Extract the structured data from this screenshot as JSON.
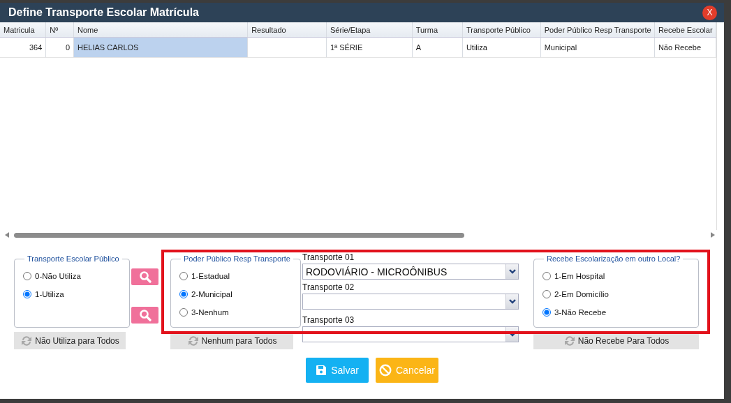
{
  "window": {
    "title": "Define Transporte Escolar Matrícula",
    "close_label": "X"
  },
  "table": {
    "columns": [
      "Matricula",
      "Nº",
      "Nome",
      "Resultado",
      "Série/Etapa",
      "Turma",
      "Transporte Público",
      "Poder Público Resp Transporte",
      "Recebe Escolar"
    ],
    "rows": [
      {
        "cells": [
          {
            "text": "364",
            "selected": false
          },
          {
            "text": "0",
            "selected": false
          },
          {
            "text": "HELIAS CARLOS",
            "selected": true
          },
          {
            "text": "",
            "selected": false
          },
          {
            "text": "1ª SÉRIE",
            "selected": false
          },
          {
            "text": "A",
            "selected": false
          },
          {
            "text": "Utiliza",
            "selected": false
          },
          {
            "text": "Municipal",
            "selected": false
          },
          {
            "text": "Não Recebe",
            "selected": false
          }
        ]
      }
    ]
  },
  "transporte_publico": {
    "legend": "Transporte Escolar Público",
    "options": [
      {
        "label": "0-Não Utiliza",
        "selected": false
      },
      {
        "label": "1-Utiliza",
        "selected": true
      }
    ],
    "all_button": "Não Utiliza para Todos"
  },
  "poder_publico": {
    "legend": "Poder Público Resp Transporte",
    "options": [
      {
        "label": "1-Estadual",
        "selected": false
      },
      {
        "label": "2-Municipal",
        "selected": true
      },
      {
        "label": "3-Nenhum",
        "selected": false
      }
    ],
    "all_button": "Nenhum para Todos"
  },
  "transportes": [
    {
      "label": "Transporte 01",
      "value": "RODOVIÁRIO - MICROÔNIBUS"
    },
    {
      "label": "Transporte 02"
    },
    {
      "label": "Transporte 03"
    }
  ],
  "escolarizacao": {
    "legend": "Recebe Escolarização em outro Local?",
    "options": [
      {
        "label": "1-Em Hospital",
        "selected": false
      },
      {
        "label": "2-Em Domicílio",
        "selected": false
      },
      {
        "label": "3-Não Recebe",
        "selected": true
      }
    ],
    "all_button": "Não Recebe Para Todos"
  },
  "actions": [
    {
      "label": "Salvar",
      "kind": "save"
    },
    {
      "label": "Cancelar",
      "kind": "cancel"
    }
  ]
}
